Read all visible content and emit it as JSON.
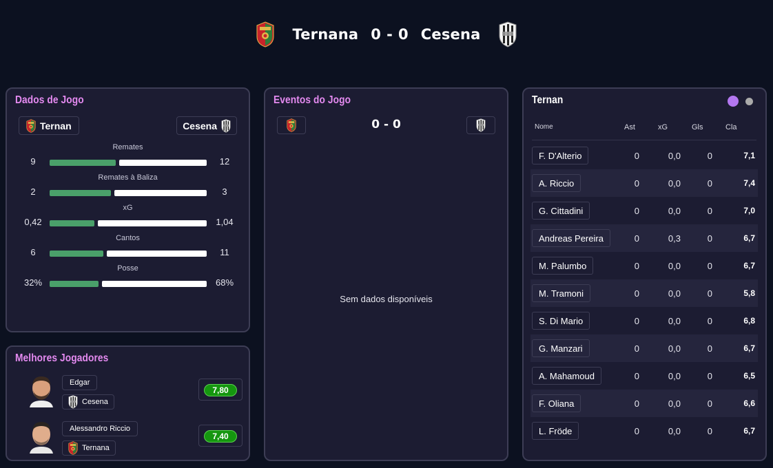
{
  "header": {
    "home_team": "Ternana",
    "away_team": "Cesena",
    "home_score": "0",
    "separator": "-",
    "away_score": "0"
  },
  "colors": {
    "accent": "#e48af0",
    "stat_home_bar": "#4aa06a",
    "stat_away_bar": "#ffffff",
    "rating_green": "#15960f",
    "toggle_active": "#b377f0",
    "toggle_inactive": "#aaaaaa"
  },
  "match_data": {
    "title": "Dados de Jogo",
    "home_label": "Ternan",
    "away_label": "Cesena",
    "stats": [
      {
        "label": "Remates",
        "home": "9",
        "away": "12",
        "home_share": 0.43
      },
      {
        "label": "Remates à Baliza",
        "home": "2",
        "away": "3",
        "home_share": 0.4
      },
      {
        "label": "xG",
        "home": "0,42",
        "away": "1,04",
        "home_share": 0.29
      },
      {
        "label": "Cantos",
        "home": "6",
        "away": "11",
        "home_share": 0.35
      },
      {
        "label": "Posse",
        "home": "32%",
        "away": "68%",
        "home_share": 0.32
      }
    ]
  },
  "events": {
    "title": "Eventos do Jogo",
    "score": "0 - 0",
    "empty_text": "Sem dados disponíveis"
  },
  "lineup": {
    "title": "Ternan",
    "columns": [
      "Nome",
      "Ast",
      "xG",
      "Gls",
      "Cla"
    ],
    "players": [
      {
        "name": "F. D'Alterio",
        "ast": "0",
        "xg": "0,0",
        "gls": "0",
        "cla": "7,1"
      },
      {
        "name": "A. Riccio",
        "ast": "0",
        "xg": "0,0",
        "gls": "0",
        "cla": "7,4"
      },
      {
        "name": "G. Cittadini",
        "ast": "0",
        "xg": "0,0",
        "gls": "0",
        "cla": "7,0"
      },
      {
        "name": "Andreas Pereira",
        "ast": "0",
        "xg": "0,3",
        "gls": "0",
        "cla": "6,7"
      },
      {
        "name": "M. Palumbo",
        "ast": "0",
        "xg": "0,0",
        "gls": "0",
        "cla": "6,7"
      },
      {
        "name": "M. Tramoni",
        "ast": "0",
        "xg": "0,0",
        "gls": "0",
        "cla": "5,8"
      },
      {
        "name": "S. Di Mario",
        "ast": "0",
        "xg": "0,0",
        "gls": "0",
        "cla": "6,8"
      },
      {
        "name": "G. Manzari",
        "ast": "0",
        "xg": "0,0",
        "gls": "0",
        "cla": "6,7"
      },
      {
        "name": "A. Mahamoud",
        "ast": "0",
        "xg": "0,0",
        "gls": "0",
        "cla": "6,5"
      },
      {
        "name": "F. Oliana",
        "ast": "0",
        "xg": "0,0",
        "gls": "0",
        "cla": "6,6"
      },
      {
        "name": "L. Fröde",
        "ast": "0",
        "xg": "0,0",
        "gls": "0",
        "cla": "6,7"
      }
    ]
  },
  "best_players": {
    "title": "Melhores Jogadores",
    "players": [
      {
        "name": "Edgar",
        "team": "Cesena",
        "rating": "7,80"
      },
      {
        "name": "Alessandro Riccio",
        "team": "Ternana",
        "rating": "7,40"
      }
    ]
  }
}
